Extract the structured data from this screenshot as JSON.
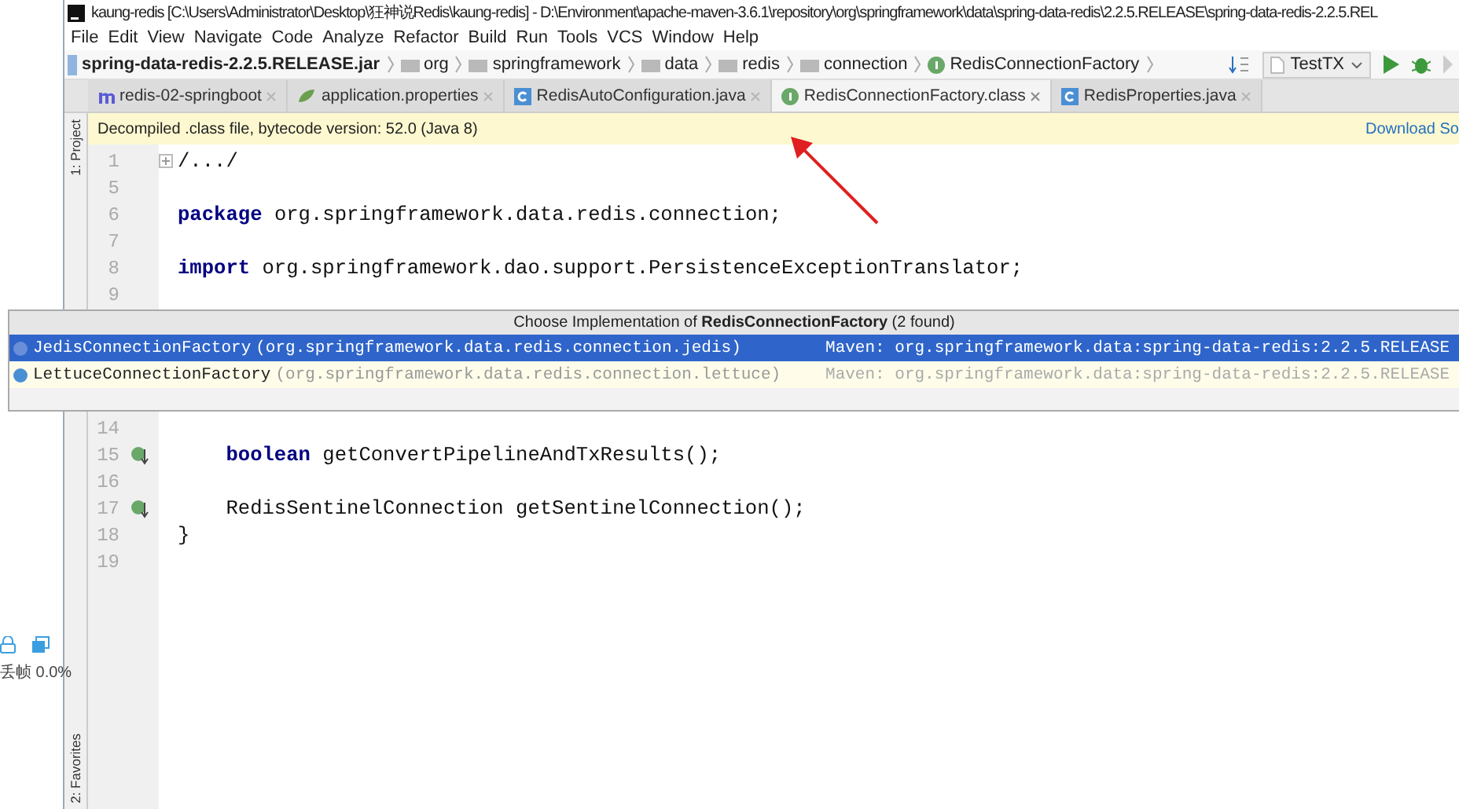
{
  "desktop": {
    "status_text": "丢帧 0.0%"
  },
  "window": {
    "title": "kaung-redis [C:\\Users\\Administrator\\Desktop\\狂神说Redis\\kaung-redis] - D:\\Environment\\apache-maven-3.6.1\\repository\\org\\springframework\\data\\spring-data-redis\\2.2.5.RELEASE\\spring-data-redis-2.2.5.REL"
  },
  "menu": [
    "File",
    "Edit",
    "View",
    "Navigate",
    "Code",
    "Analyze",
    "Refactor",
    "Build",
    "Run",
    "Tools",
    "VCS",
    "Window",
    "Help"
  ],
  "breadcrumbs": [
    {
      "kind": "jar",
      "label": "spring-data-redis-2.2.5.RELEASE.jar"
    },
    {
      "kind": "folder",
      "label": "org"
    },
    {
      "kind": "folder",
      "label": "springframework"
    },
    {
      "kind": "folder",
      "label": "data"
    },
    {
      "kind": "folder",
      "label": "redis"
    },
    {
      "kind": "folder",
      "label": "connection"
    },
    {
      "kind": "interface",
      "label": "RedisConnectionFactory"
    }
  ],
  "run_config": {
    "label": "TestTX"
  },
  "tabs": [
    {
      "kind": "maven",
      "label": "redis-02-springboot",
      "selected": false
    },
    {
      "kind": "properties",
      "label": "application.properties",
      "selected": false
    },
    {
      "kind": "class",
      "label": "RedisAutoConfiguration.java",
      "selected": false
    },
    {
      "kind": "interface",
      "label": "RedisConnectionFactory.class",
      "selected": true
    },
    {
      "kind": "class",
      "label": "RedisProperties.java",
      "selected": false
    }
  ],
  "tool_windows": {
    "top": "1: Project",
    "bottom": "2: Favorites"
  },
  "banner": {
    "text": "Decompiled .class file, bytecode version: 52.0 (Java 8)",
    "link": "Download So"
  },
  "code_lines": [
    {
      "number": "1",
      "text": "/.../",
      "folded": true
    },
    {
      "number": "5"
    },
    {
      "number": "6",
      "keyword": "package",
      "text": " org.springframework.data.redis.connection;"
    },
    {
      "number": "7"
    },
    {
      "number": "8",
      "keyword": "import",
      "text": " org.springframework.dao.support.PersistenceExceptionTranslator;"
    },
    {
      "number": "9"
    }
  ],
  "code_lines_below": [
    {
      "number": "14"
    },
    {
      "number": "15",
      "keyword": "    boolean",
      "text": " getConvertPipelineAndTxResults();",
      "gutter_marker": true
    },
    {
      "number": "16"
    },
    {
      "number": "17",
      "text": "    RedisSentinelConnection getSentinelConnection();",
      "gutter_marker": true
    },
    {
      "number": "18",
      "text": "}"
    },
    {
      "number": "19"
    }
  ],
  "popup": {
    "title": "Choose Implementation of **RedisConnectionFactory** (2 found)",
    "items": [
      {
        "name": "JedisConnectionFactory",
        "package": "(org.springframework.data.redis.connection.jedis)",
        "module": "Maven: org.springframework.data:spring-data-redis:2.2.5.RELEASE",
        "selected": true
      },
      {
        "name": "LettuceConnectionFactory",
        "package": "(org.springframework.data.redis.connection.lettuce)",
        "module": "Maven: org.springframework.data:spring-data-redis:2.2.5.RELEASE",
        "selected": false
      }
    ]
  }
}
